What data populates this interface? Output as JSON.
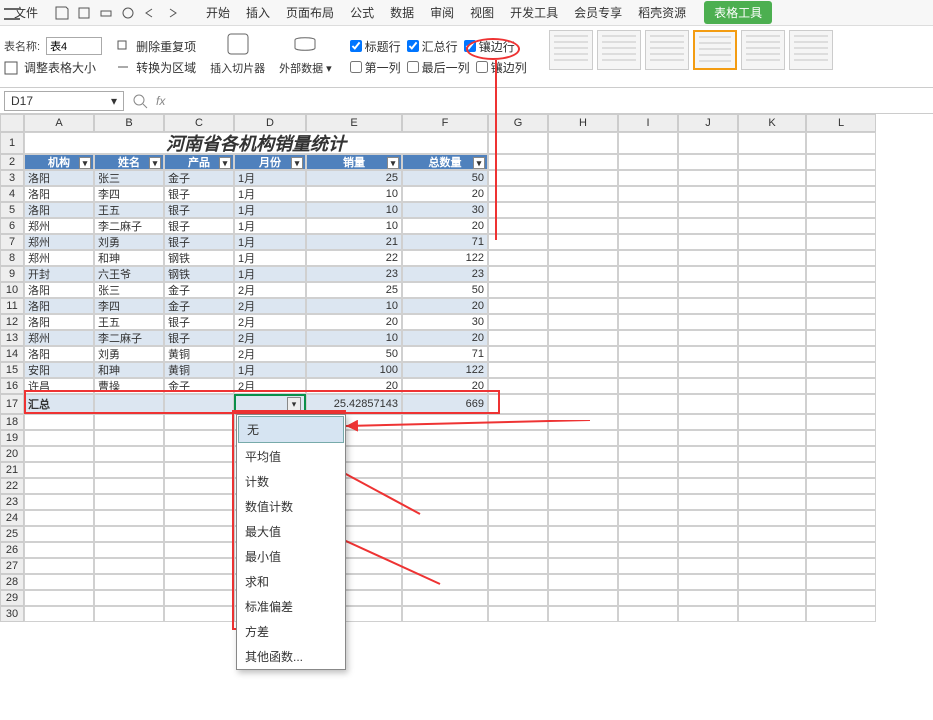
{
  "menubar": {
    "file": "文件",
    "tabs": [
      "开始",
      "插入",
      "页面布局",
      "公式",
      "数据",
      "审阅",
      "视图",
      "开发工具",
      "会员专享",
      "稻壳资源"
    ],
    "tool_button": "表格工具"
  },
  "ribbon": {
    "table_name_label": "表名称:",
    "table_name_value": "表4",
    "resize_label": "调整表格大小",
    "remove_dup": "删除重复项",
    "to_range": "转换为区域",
    "insert_slicer": "插入切片器",
    "external_data": "外部数据",
    "checks": {
      "header_row": "标题行",
      "total_row": "汇总行",
      "banded_rows": "镶边行",
      "first_col": "第一列",
      "last_col": "最后一列",
      "banded_cols": "镶边列"
    }
  },
  "namebox": {
    "cell_ref": "D17"
  },
  "columns": [
    "A",
    "B",
    "C",
    "D",
    "E",
    "F",
    "G",
    "H",
    "I",
    "J",
    "K",
    "L"
  ],
  "sheet": {
    "title": "河南省各机构销量统计",
    "headers": [
      "机构",
      "姓名",
      "产品",
      "月份",
      "销量",
      "总数量"
    ],
    "rows": [
      {
        "r": 3,
        "c": [
          "洛阳",
          "张三",
          "金子",
          "1月",
          "25",
          "50"
        ]
      },
      {
        "r": 4,
        "c": [
          "洛阳",
          "李四",
          "银子",
          "1月",
          "10",
          "20"
        ]
      },
      {
        "r": 5,
        "c": [
          "洛阳",
          "王五",
          "银子",
          "1月",
          "10",
          "30"
        ]
      },
      {
        "r": 6,
        "c": [
          "郑州",
          "李二麻子",
          "银子",
          "1月",
          "10",
          "20"
        ]
      },
      {
        "r": 7,
        "c": [
          "郑州",
          "刘勇",
          "银子",
          "1月",
          "21",
          "71"
        ]
      },
      {
        "r": 8,
        "c": [
          "郑州",
          "和珅",
          "钢铁",
          "1月",
          "22",
          "122"
        ]
      },
      {
        "r": 9,
        "c": [
          "开封",
          "六王爷",
          "钢铁",
          "1月",
          "23",
          "23"
        ]
      },
      {
        "r": 10,
        "c": [
          "洛阳",
          "张三",
          "金子",
          "2月",
          "25",
          "50"
        ]
      },
      {
        "r": 11,
        "c": [
          "洛阳",
          "李四",
          "金子",
          "2月",
          "10",
          "20"
        ]
      },
      {
        "r": 12,
        "c": [
          "洛阳",
          "王五",
          "银子",
          "2月",
          "20",
          "30"
        ]
      },
      {
        "r": 13,
        "c": [
          "郑州",
          "李二麻子",
          "银子",
          "2月",
          "10",
          "20"
        ]
      },
      {
        "r": 14,
        "c": [
          "洛阳",
          "刘勇",
          "黄铜",
          "2月",
          "50",
          "71"
        ]
      },
      {
        "r": 15,
        "c": [
          "安阳",
          "和珅",
          "黄铜",
          "1月",
          "100",
          "122"
        ]
      },
      {
        "r": 16,
        "c": [
          "许昌",
          "曹操",
          "金子",
          "2月",
          "20",
          "20"
        ]
      }
    ],
    "totals": {
      "label": "汇总",
      "e_value": "25.42857143",
      "f_value": "669"
    }
  },
  "dropdown": {
    "items": [
      "无",
      "平均值",
      "计数",
      "数值计数",
      "最大值",
      "最小值",
      "求和",
      "标准偏差",
      "方差",
      "其他函数..."
    ]
  }
}
